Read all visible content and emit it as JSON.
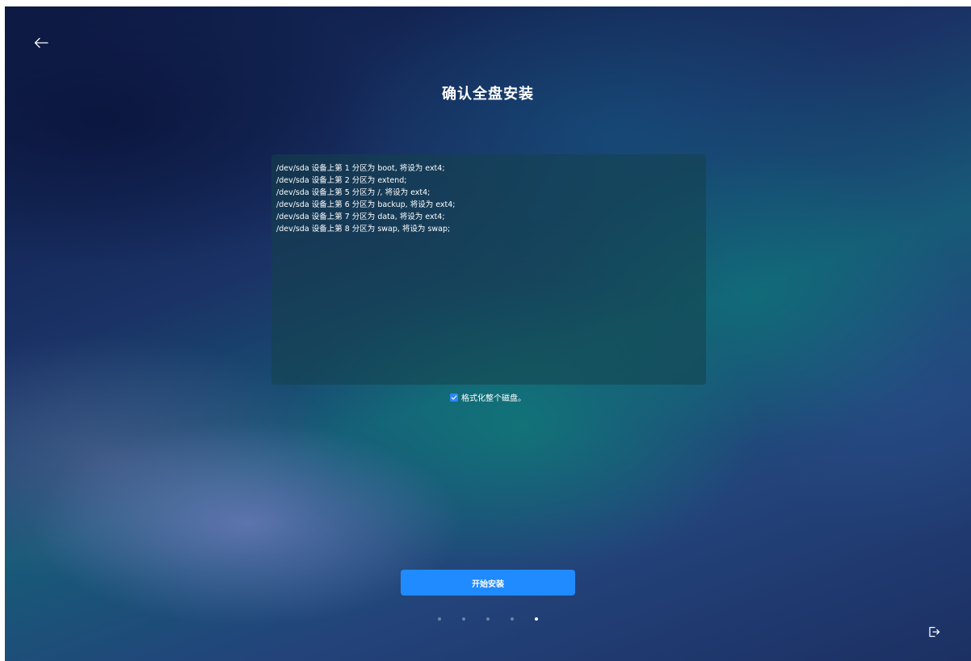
{
  "header": {
    "title": "确认全盘安装"
  },
  "partition_info": {
    "lines": [
      "/dev/sda 设备上第 1 分区为 boot, 将设为 ext4;",
      "/dev/sda 设备上第 2 分区为 extend;",
      "/dev/sda 设备上第 5 分区为 /, 将设为 ext4;",
      "/dev/sda 设备上第 6 分区为 backup, 将设为 ext4;",
      "/dev/sda 设备上第 7 分区为 data, 将设为 ext4;",
      "/dev/sda 设备上第 8 分区为 swap, 将设为 swap;"
    ]
  },
  "format_option": {
    "label": "格式化整个磁盘。",
    "checked": true
  },
  "actions": {
    "start_install_label": "开始安装"
  },
  "progress": {
    "total_steps": 5,
    "current_step": 5
  },
  "icons": {
    "back": "arrow-left-icon",
    "exit": "exit-icon",
    "check": "checkmark-icon"
  },
  "colors": {
    "accent": "#1f8bff",
    "checkbox": "#2e86ff",
    "text": "#ffffff"
  }
}
